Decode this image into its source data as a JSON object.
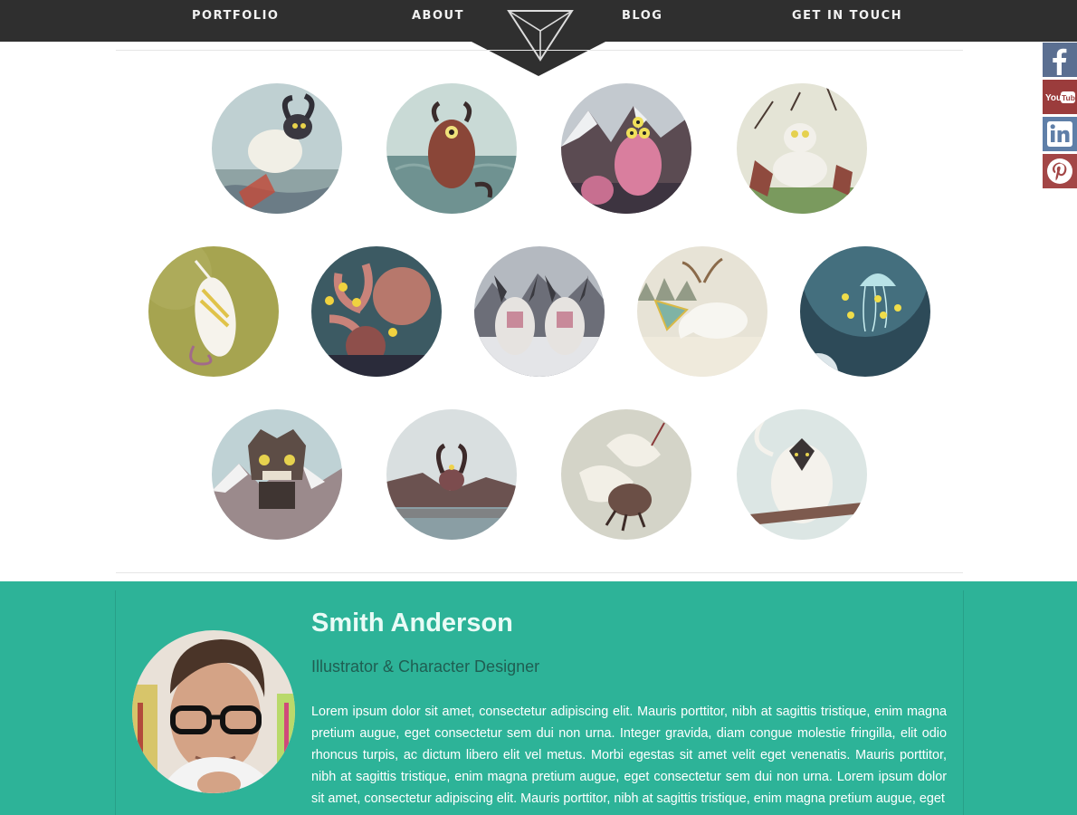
{
  "nav": {
    "items": [
      "PORTFOLIO",
      "ABOUT",
      "BLOG",
      "GET IN TOUCH"
    ],
    "logo_icon": "triangle-logo-icon"
  },
  "social": [
    {
      "name": "facebook",
      "icon": "facebook-icon",
      "color": "#5b6f91"
    },
    {
      "name": "youtube",
      "icon": "youtube-icon",
      "label": "You Tube",
      "color": "#9b3c3c"
    },
    {
      "name": "linkedin",
      "icon": "linkedin-icon",
      "color": "#5f7fa8"
    },
    {
      "name": "pinterest",
      "icon": "pinterest-icon",
      "color": "#a34646"
    }
  ],
  "gallery": {
    "count": 13,
    "rows": [
      4,
      5,
      4
    ]
  },
  "profile": {
    "name": "Smith Anderson",
    "role": "Illustrator & Character Designer",
    "bio": "Lorem ipsum dolor sit amet, consectetur adipiscing elit. Mauris porttitor, nibh at sagittis tristique, enim magna pretium augue, eget consectetur sem dui non urna. Integer gravida, diam congue molestie fringilla, elit odio rhoncus turpis, ac dictum libero elit vel metus. Morbi egestas sit amet velit eget venenatis. Mauris porttitor, nibh at sagittis tristique, enim magna pretium augue, eget consectetur sem dui non urna. Lorem ipsum dolor sit amet, consectetur adipiscing elit. Mauris porttitor, nibh at sagittis tristique, enim magna pretium augue, eget",
    "accent": "#2db398"
  }
}
